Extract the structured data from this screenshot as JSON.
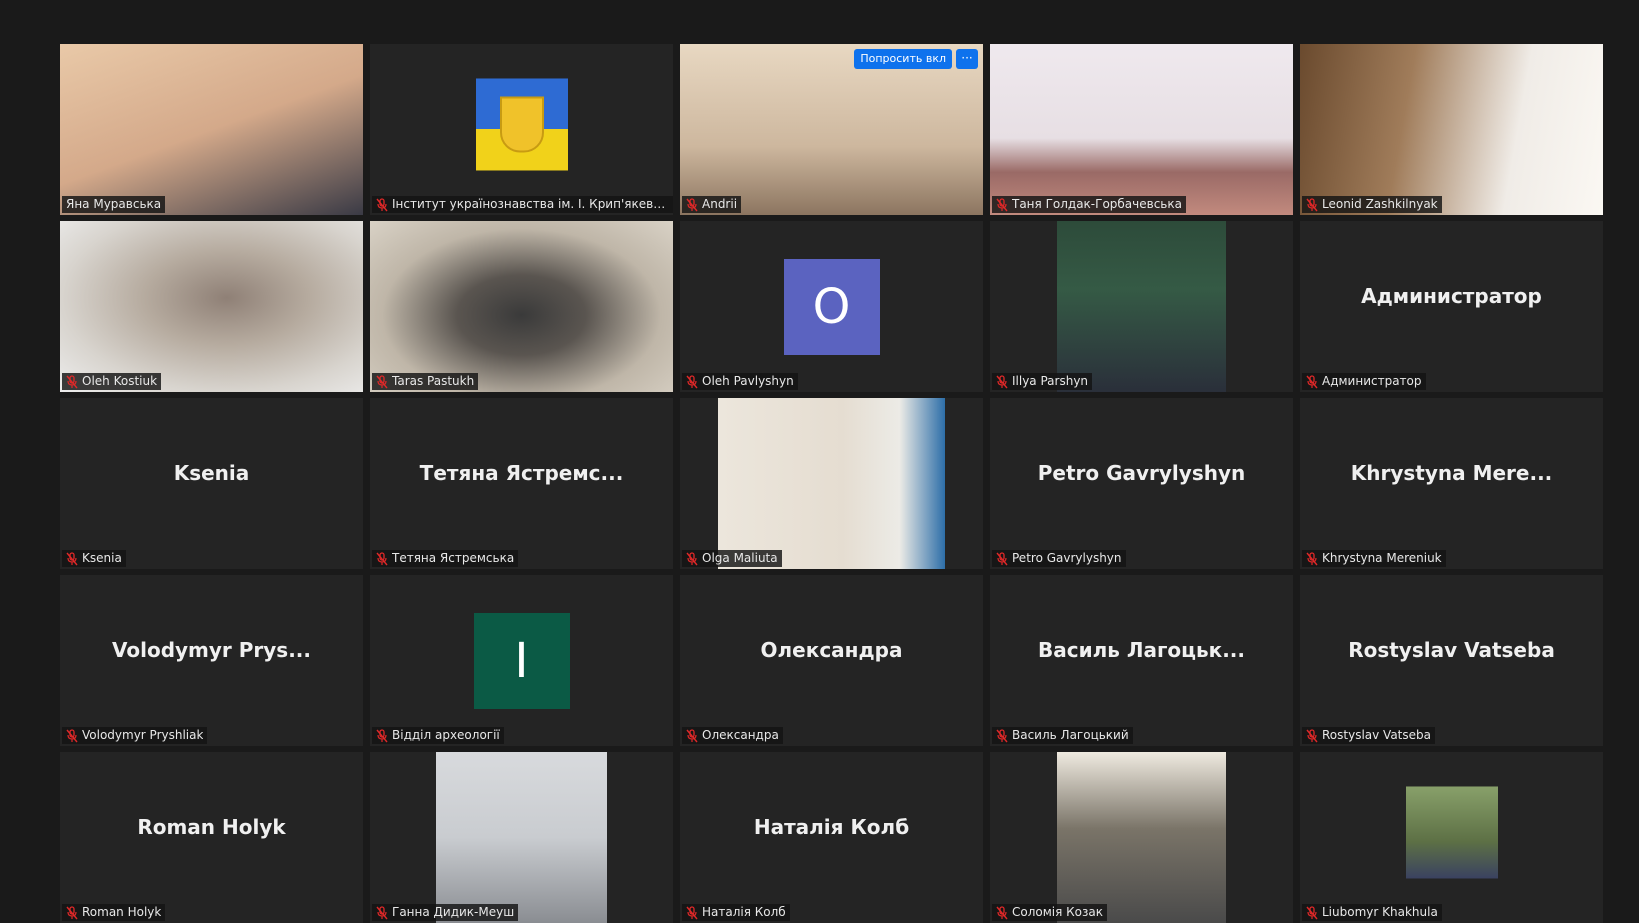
{
  "app": {
    "name": "Zoom gallery view"
  },
  "colors": {
    "background": "#1a1a1a",
    "tile": "#242424",
    "active_speaker_border": "#d9e35a",
    "muted_mic": "#e02828",
    "ask_button": "#0e72ed",
    "avatar_o": "#5b63c0",
    "avatar_i": "#0b5a45"
  },
  "request_video": {
    "label": "Попросить вкл",
    "more_label": "···"
  },
  "participants": [
    {
      "name": "Яна Муравська",
      "display": "video",
      "muted": false,
      "active_speaker": true,
      "big_label": ""
    },
    {
      "name": "Інститут українознавства ім. І. Крип'якевича ...",
      "display": "image",
      "muted": true,
      "big_label": ""
    },
    {
      "name": "Andrii",
      "display": "video",
      "muted": true,
      "big_label": ""
    },
    {
      "name": "Таня Голдак-Горбачевська",
      "display": "video",
      "muted": true,
      "big_label": ""
    },
    {
      "name": "Leonid Zashkilnyak",
      "display": "video",
      "muted": true,
      "big_label": ""
    },
    {
      "name": "Oleh Kostiuk",
      "display": "video",
      "muted": true,
      "big_label": ""
    },
    {
      "name": "Taras Pastukh",
      "display": "video",
      "muted": true,
      "big_label": ""
    },
    {
      "name": "Oleh Pavlyshyn",
      "display": "avatar",
      "muted": true,
      "big_label": "",
      "avatar_letter": "O"
    },
    {
      "name": "Illya Parshyn",
      "display": "image",
      "muted": true,
      "big_label": ""
    },
    {
      "name": "Администратор",
      "display": "name",
      "muted": true,
      "big_label": "Администратор"
    },
    {
      "name": "Ksenia",
      "display": "name",
      "muted": true,
      "big_label": "Ksenia"
    },
    {
      "name": "Тетяна Ястремська",
      "display": "name",
      "muted": true,
      "big_label": "Тетяна  Ястремс..."
    },
    {
      "name": "Olga Maliuta",
      "display": "video",
      "muted": true,
      "big_label": ""
    },
    {
      "name": "Petro Gavrylyshyn",
      "display": "name",
      "muted": true,
      "big_label": "Petro Gavrylyshyn"
    },
    {
      "name": "Khrystyna Mereniuk",
      "display": "name",
      "muted": true,
      "big_label": "Khrystyna  Mere..."
    },
    {
      "name": "Volodymyr Pryshliak",
      "display": "name",
      "muted": true,
      "big_label": "Volodymyr  Prys..."
    },
    {
      "name": "Відділ археології",
      "display": "avatar",
      "muted": true,
      "big_label": "",
      "avatar_letter": "I"
    },
    {
      "name": "Олександра",
      "display": "name",
      "muted": true,
      "big_label": "Олександра"
    },
    {
      "name": "Василь Лагоцький",
      "display": "name",
      "muted": true,
      "big_label": "Василь  Лагоцьк..."
    },
    {
      "name": "Rostyslav Vatseba",
      "display": "name",
      "muted": true,
      "big_label": "Rostyslav Vatseba"
    },
    {
      "name": "Roman Holyk",
      "display": "name",
      "muted": true,
      "big_label": "Roman Holyk"
    },
    {
      "name": "Ганна Дидик-Меуш",
      "display": "image",
      "muted": true,
      "big_label": ""
    },
    {
      "name": "Наталія Колб",
      "display": "name",
      "muted": true,
      "big_label": "Наталія Колб"
    },
    {
      "name": "Соломія Козак",
      "display": "image",
      "muted": true,
      "big_label": ""
    },
    {
      "name": "Liubomyr Khakhula",
      "display": "image",
      "muted": true,
      "big_label": ""
    }
  ]
}
